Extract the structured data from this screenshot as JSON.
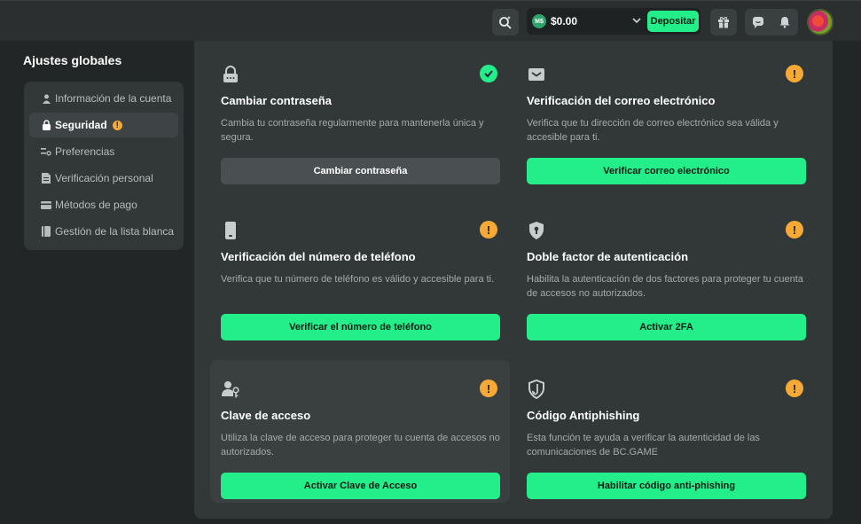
{
  "header": {
    "balance": "$0.00",
    "coin_label": "M$",
    "deposit_label": "Depositar"
  },
  "sidebar": {
    "title": "Ajustes globales",
    "items": [
      {
        "label": "Información de la cuenta",
        "icon": "user-icon"
      },
      {
        "label": "Seguridad",
        "icon": "lock-icon",
        "badge": "!"
      },
      {
        "label": "Preferencias",
        "icon": "preferences-icon"
      },
      {
        "label": "Verificación personal",
        "icon": "document-icon"
      },
      {
        "label": "Métodos de pago",
        "icon": "card-icon"
      },
      {
        "label": "Gestión de la lista blanca",
        "icon": "whitelist-icon"
      }
    ]
  },
  "cards": [
    {
      "title": "Cambiar contraseña",
      "desc": "Cambia tu contraseña regularmente para mantenerla única y segura.",
      "button": "Cambiar contraseña",
      "status": "ok"
    },
    {
      "title": "Verificación del correo electrónico",
      "desc": "Verifica que tu dirección de correo electrónico sea válida y accesible para ti.",
      "button": "Verificar correo electrónico",
      "status": "warn"
    },
    {
      "title": "Verificación del número de teléfono",
      "desc": "Verifica que tu número de teléfono es válido y accesible para ti.",
      "button": "Verificar el número de teléfono",
      "status": "warn"
    },
    {
      "title": "Doble factor de autenticación",
      "desc": "Habilita la autenticación de dos factores para proteger tu cuenta de accesos no autorizados.",
      "button": "Activar 2FA",
      "status": "warn"
    },
    {
      "title": "Clave de acceso",
      "desc": "Utiliza la clave de acceso para proteger tu cuenta de accesos no autorizados.",
      "button": "Activar Clave de Acceso",
      "status": "warn"
    },
    {
      "title": "Código Antiphishing",
      "desc": "Esta función te ayuda a verificar la autenticidad de las comunicaciones de BC.GAME",
      "button": "Habilitar código anti-phishing",
      "status": "warn"
    }
  ],
  "status_warn_glyph": "!",
  "colors": {
    "accent": "#24ee89",
    "warning": "#f6a935"
  }
}
